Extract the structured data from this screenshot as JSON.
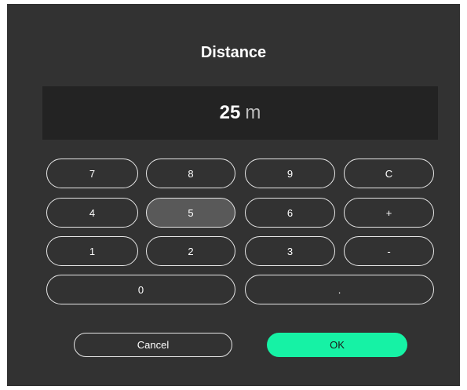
{
  "dialog": {
    "title": "Distance",
    "display": {
      "value": "25",
      "unit": "m"
    },
    "keypad": {
      "k7": "7",
      "k8": "8",
      "k9": "9",
      "clear": "C",
      "k4": "4",
      "k5": "5",
      "k6": "6",
      "plus": "+",
      "k1": "1",
      "k2": "2",
      "k3": "3",
      "minus": "-",
      "k0": "0",
      "decimal": "."
    },
    "actions": {
      "cancel_label": "Cancel",
      "ok_label": "OK"
    }
  },
  "colors": {
    "dialog_background": "#323232",
    "display_background": "#232323",
    "key_border": "#e6e6e6",
    "key_pressed": "#595959",
    "ok_accent": "#16f2a5"
  }
}
